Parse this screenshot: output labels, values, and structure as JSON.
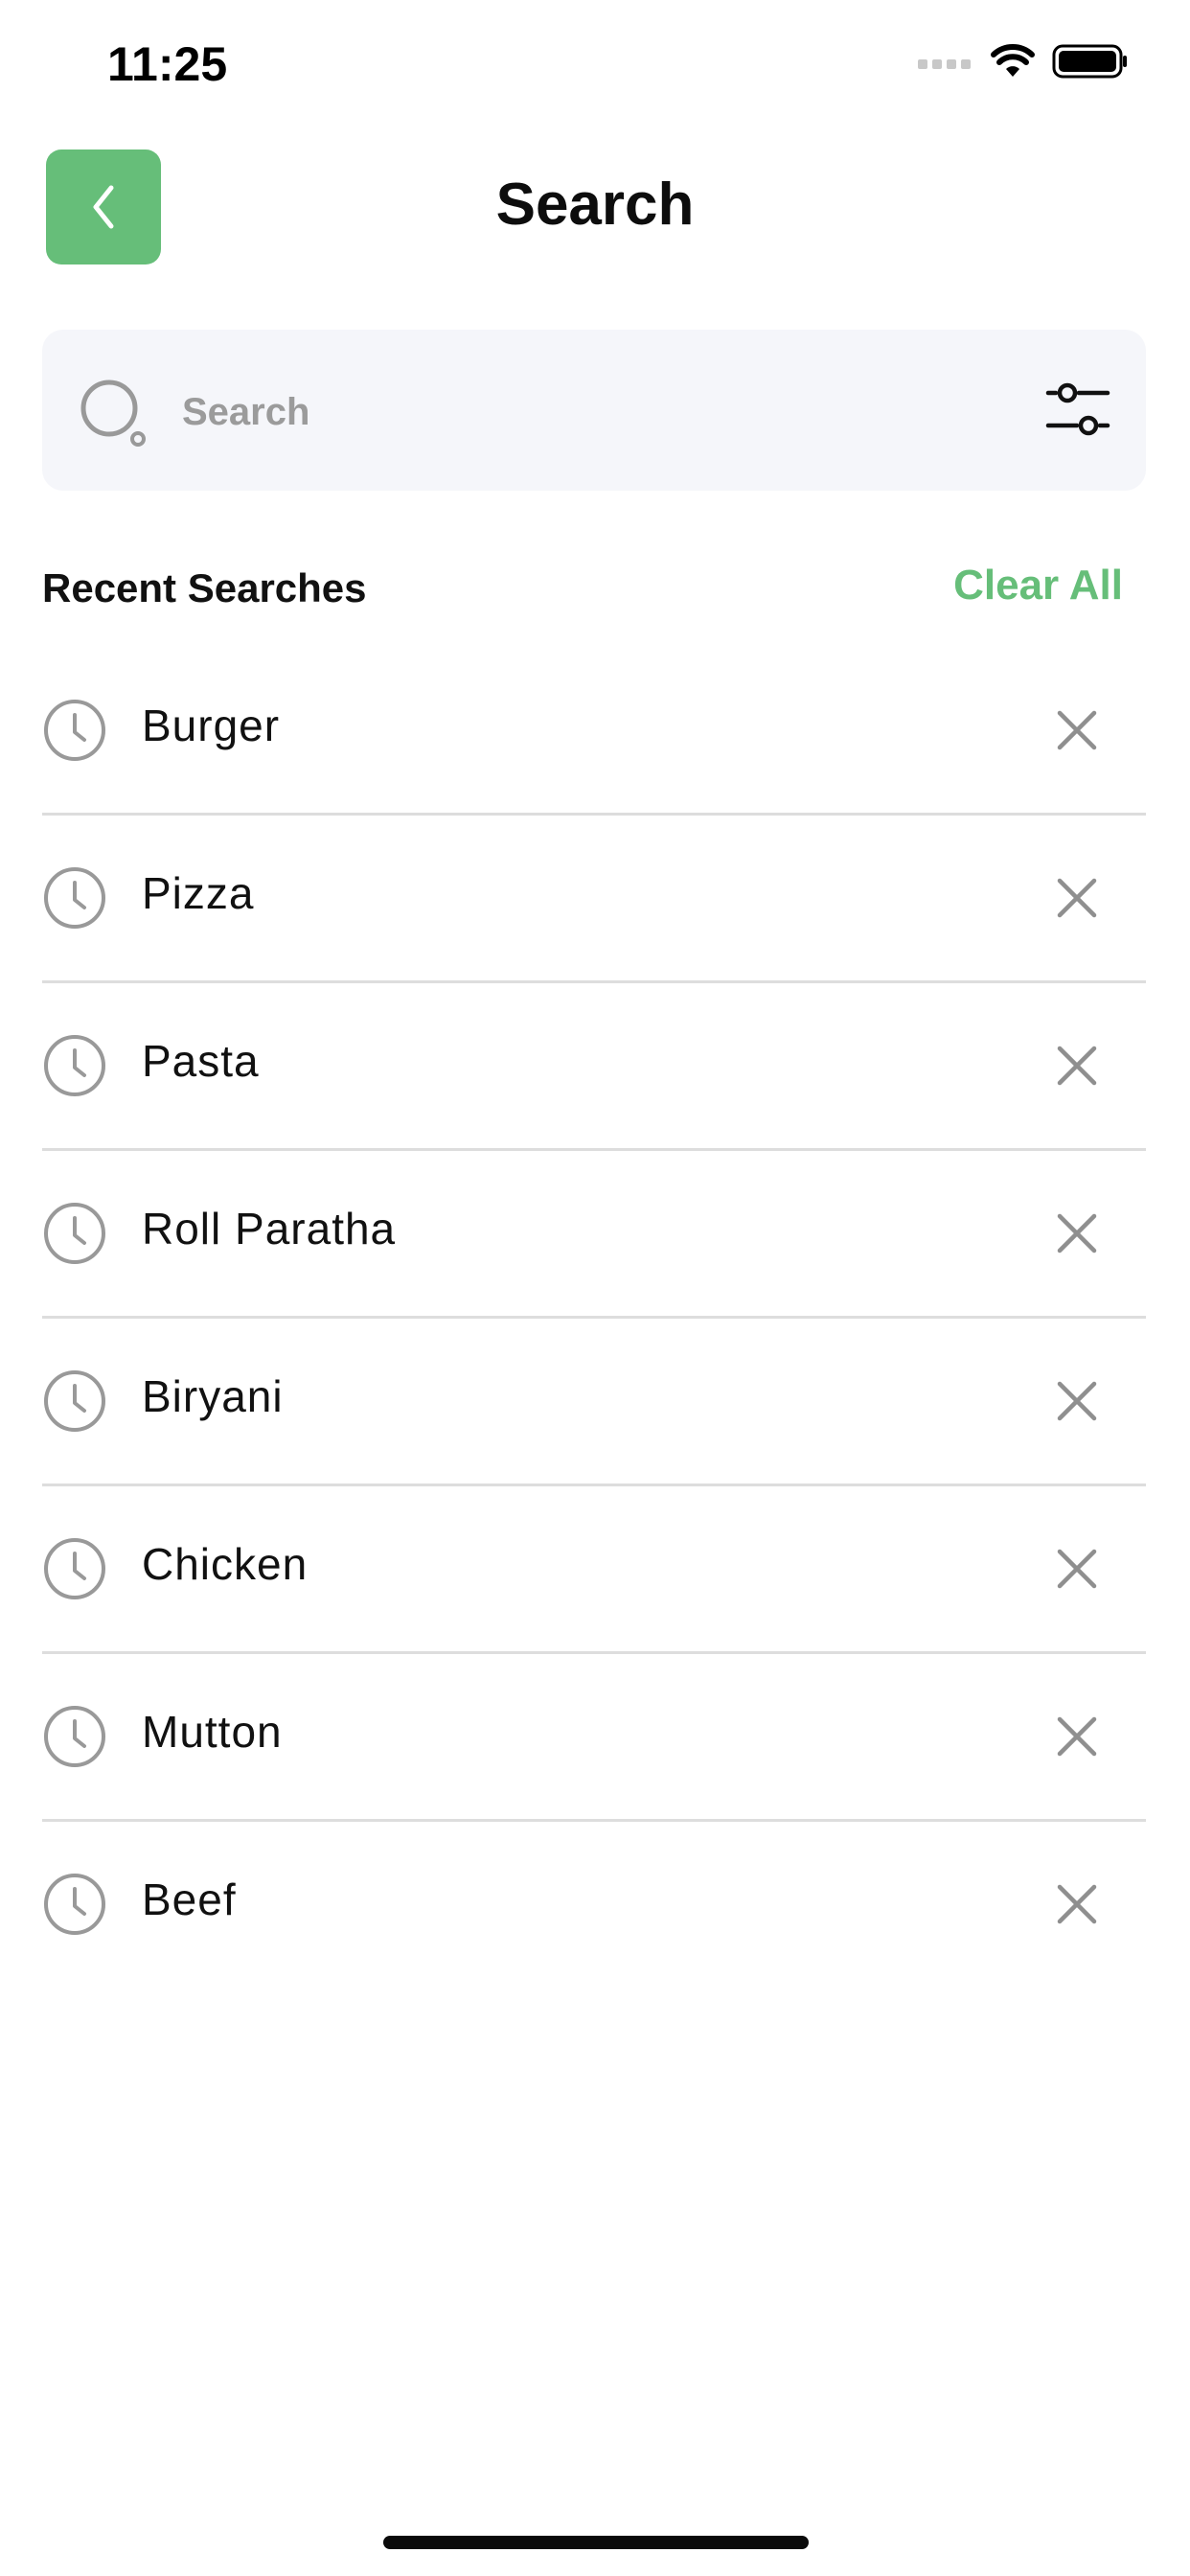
{
  "status_bar": {
    "time": "11:25"
  },
  "header": {
    "title": "Search",
    "back_icon": "chevron-left-icon"
  },
  "search": {
    "placeholder": "Search",
    "value": "",
    "search_icon": "search-icon",
    "filter_icon": "sliders-icon"
  },
  "recent": {
    "title": "Recent Searches",
    "clear_label": "Clear All",
    "items": [
      {
        "label": "Burger"
      },
      {
        "label": "Pizza"
      },
      {
        "label": "Pasta"
      },
      {
        "label": "Roll Paratha"
      },
      {
        "label": "Biryani"
      },
      {
        "label": "Chicken"
      },
      {
        "label": "Mutton"
      },
      {
        "label": "Beef"
      }
    ],
    "item_icon": "clock-icon",
    "remove_icon": "close-icon"
  },
  "colors": {
    "accent": "#66be79",
    "search_background": "#f5f6fa",
    "divider": "#dddddd",
    "icon_gray": "#999999"
  }
}
